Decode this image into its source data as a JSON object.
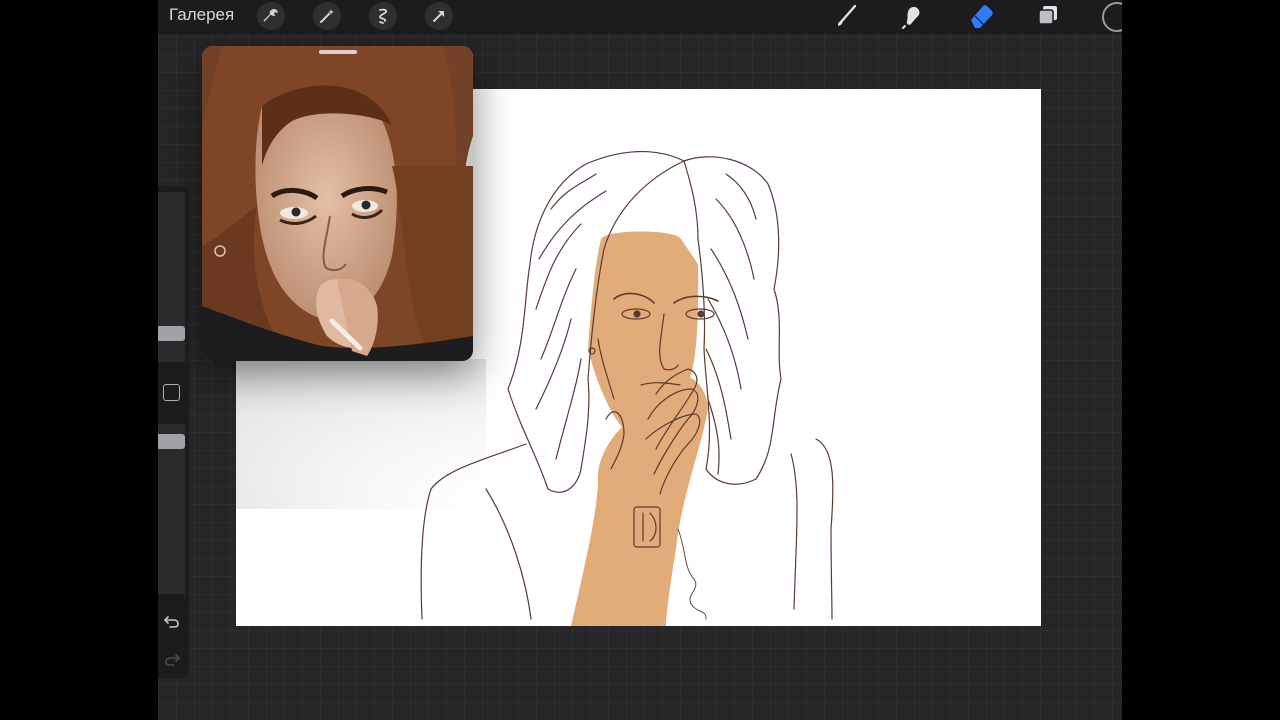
{
  "topbar": {
    "gallery_label": "Галерея",
    "left_tools": [
      {
        "icon": "wrench-icon"
      },
      {
        "icon": "magic-wand-icon"
      },
      {
        "icon": "selection-icon"
      },
      {
        "icon": "transform-arrow-icon"
      }
    ],
    "right_tools": [
      {
        "icon": "brush-icon"
      },
      {
        "icon": "smudge-icon"
      },
      {
        "icon": "eraser-icon",
        "active": true
      },
      {
        "icon": "layers-icon"
      }
    ],
    "active_color": "#1c1c1e",
    "active_tool_color": "#2f7cf6"
  },
  "sidebar": {
    "brush_size": 0.31,
    "opacity": 0.85,
    "undo_icon": "undo-icon",
    "redo_icon": "redo-icon"
  },
  "colors": {
    "skin": "#e2ab7a",
    "line": "#5b3b30",
    "hair_reference": "#7a4526"
  }
}
